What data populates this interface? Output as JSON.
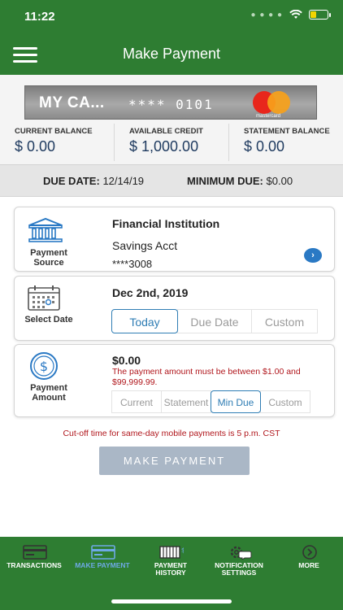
{
  "status_bar": {
    "time": "11:22"
  },
  "header": {
    "title": "Make Payment"
  },
  "card": {
    "name": "MY CA...",
    "number": "**** 0101",
    "brand": "mastercard"
  },
  "balances": [
    {
      "label": "CURRENT BALANCE",
      "value": "$ 0.00"
    },
    {
      "label": "AVAILABLE CREDIT",
      "value": "$ 1,000.00"
    },
    {
      "label": "STATEMENT BALANCE",
      "value": "$ 0.00"
    }
  ],
  "due": {
    "date_label": "DUE DATE:",
    "date_value": "12/14/19",
    "min_label": "MINIMUM DUE:",
    "min_value": "$0.00"
  },
  "payment_source": {
    "label_line1": "Payment",
    "label_line2": "Source",
    "institution": "Financial Institution",
    "account_name": "Savings Acct",
    "account_number": "****3008",
    "icon": "bank-icon"
  },
  "select_date": {
    "label": "Select Date",
    "value": "Dec 2nd, 2019",
    "options": [
      "Today",
      "Due Date",
      "Custom"
    ],
    "selected": "Today",
    "icon": "calendar-icon"
  },
  "payment_amount": {
    "label_line1": "Payment",
    "label_line2": "Amount",
    "value": "$0.00",
    "error": "The payment amount must be between $1.00 and $99,999.99.",
    "options": [
      "Current",
      "Statement",
      "Min Due",
      "Custom"
    ],
    "selected": "Min Due",
    "icon": "dollar-icon"
  },
  "cutoff_text": "Cut-off time for same-day mobile payments is 5 p.m. CST",
  "make_payment_label": "MAKE PAYMENT",
  "bottom_nav": {
    "items": [
      {
        "line1": "TRANSACTIONS",
        "line2": "",
        "icon": "card-icon"
      },
      {
        "line1": "MAKE PAYMENT",
        "line2": "",
        "icon": "card-icon",
        "active": true
      },
      {
        "line1": "PAYMENT",
        "line2": "HISTORY",
        "icon": "history-icon"
      },
      {
        "line1": "NOTIFICATION",
        "line2": "SETTINGS",
        "icon": "gear-chat-icon"
      },
      {
        "line1": "MORE",
        "line2": "",
        "icon": "chevron-right-icon"
      }
    ]
  },
  "colors": {
    "brand_green": "#2e7d32",
    "accent_blue": "#2f7db4",
    "error_red": "#b0161c",
    "button_disabled": "#aab7c6"
  }
}
